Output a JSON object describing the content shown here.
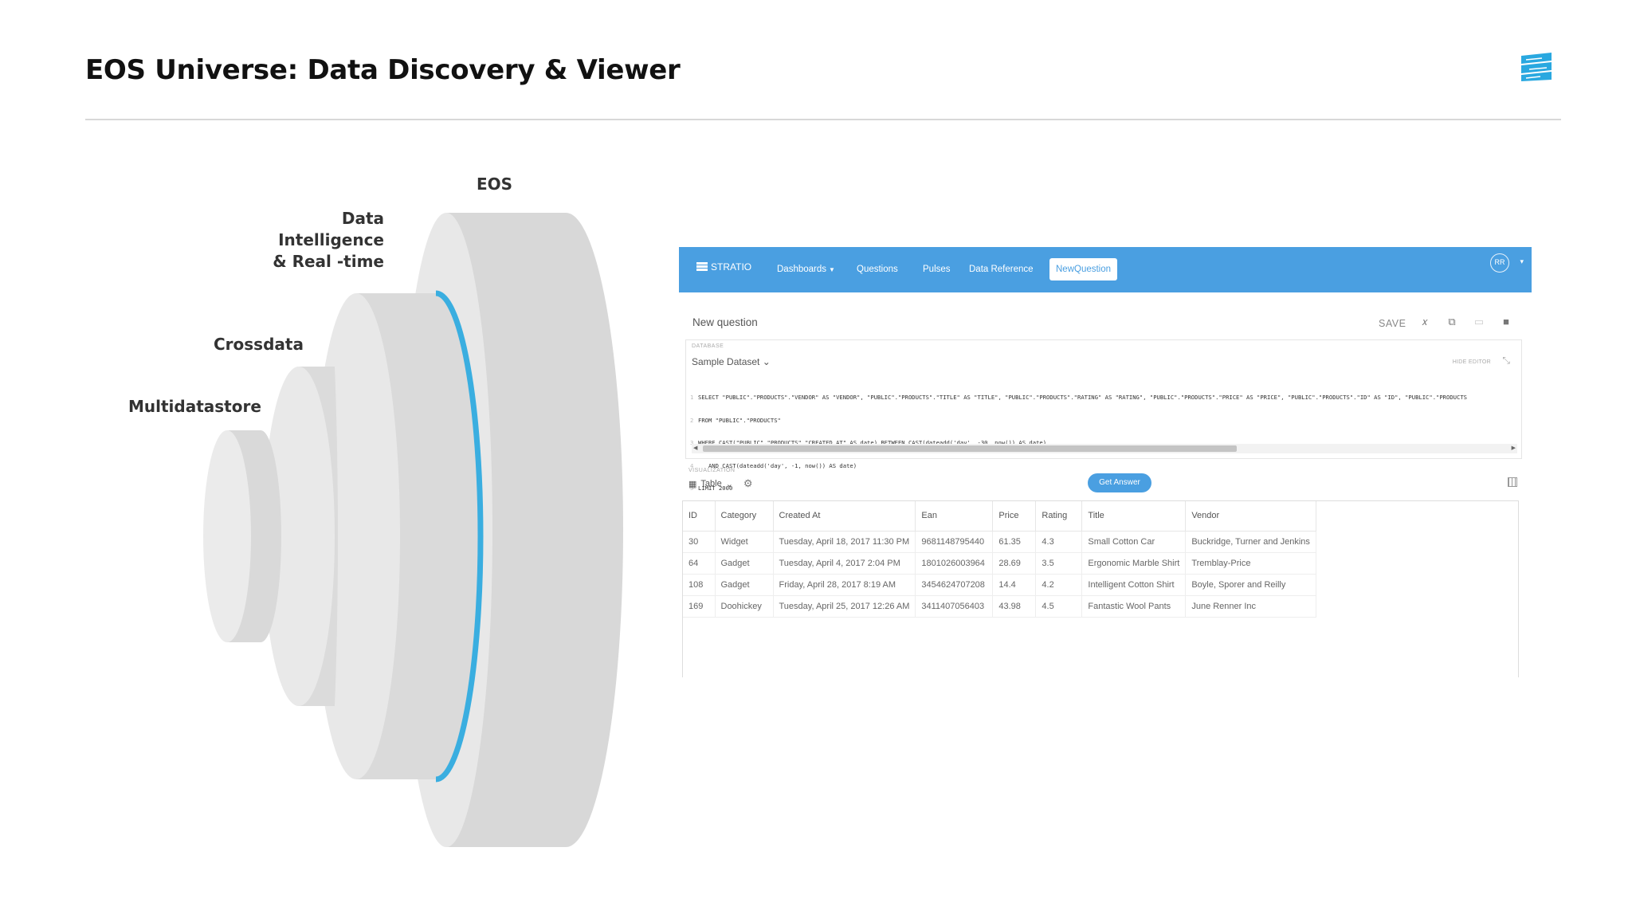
{
  "slide": {
    "title": "EOS Universe: Data Discovery & Viewer"
  },
  "diagram": {
    "labels": {
      "eos": "EOS",
      "data_intelligence": [
        "Data",
        "Intelligence",
        "& Real -time"
      ],
      "crossdata": "Crossdata",
      "multidatastore": "Multidatastore"
    },
    "colors": {
      "disc": "#e6e6e6",
      "disc_side": "#d9d9d9",
      "highlight": "#3aaee0"
    }
  },
  "app": {
    "colors": {
      "primary": "#4a9fe1"
    },
    "navbar": {
      "brand": "STRATIO",
      "items": [
        "Dashboards",
        "Questions",
        "Pulses",
        "Data Reference"
      ],
      "active_item": "NewQuestion",
      "avatar": "RR"
    },
    "header": {
      "title": "New question",
      "save_label": "SAVE"
    },
    "editor": {
      "database_label": "DATABASE",
      "database_value": "Sample Dataset",
      "hide_editor_label": "HIDE EDITOR",
      "sql_lines": [
        "SELECT \"PUBLIC\".\"PRODUCTS\".\"VENDOR\" AS \"VENDOR\", \"PUBLIC\".\"PRODUCTS\".\"TITLE\" AS \"TITLE\", \"PUBLIC\".\"PRODUCTS\".\"RATING\" AS \"RATING\", \"PUBLIC\".\"PRODUCTS\".\"PRICE\" AS \"PRICE\", \"PUBLIC\".\"PRODUCTS\".\"ID\" AS \"ID\", \"PUBLIC\".\"PRODUCTS",
        "FROM \"PUBLIC\".\"PRODUCTS\"",
        "WHERE CAST(\"PUBLIC\".\"PRODUCTS\".\"CREATED_AT\" AS date) BETWEEN CAST(dateadd('day', -30, now()) AS date)",
        "   AND CAST(dateadd('day', -1, now()) AS date)",
        "LIMIT 2000"
      ]
    },
    "visualization": {
      "label": "VISUALIZATION",
      "value": "Table",
      "get_answer": "Get Answer"
    },
    "table": {
      "columns": [
        "ID",
        "Category",
        "Created At",
        "Ean",
        "Price",
        "Rating",
        "Title",
        "Vendor"
      ],
      "rows": [
        [
          "30",
          "Widget",
          "Tuesday, April 18, 2017 11:30 PM",
          "9681148795440",
          "61.35",
          "4.3",
          "Small Cotton Car",
          "Buckridge, Turner and Jenkins"
        ],
        [
          "64",
          "Gadget",
          "Tuesday, April 4, 2017 2:04 PM",
          "1801026003964",
          "28.69",
          "3.5",
          "Ergonomic Marble Shirt",
          "Tremblay-Price"
        ],
        [
          "108",
          "Gadget",
          "Friday, April 28, 2017 8:19 AM",
          "3454624707208",
          "14.4",
          "4.2",
          "Intelligent Cotton Shirt",
          "Boyle, Sporer and Reilly"
        ],
        [
          "169",
          "Doohickey",
          "Tuesday, April 25, 2017 12:26 AM",
          "3411407056403",
          "43.98",
          "4.5",
          "Fantastic Wool Pants",
          "June Renner Inc"
        ]
      ]
    }
  }
}
